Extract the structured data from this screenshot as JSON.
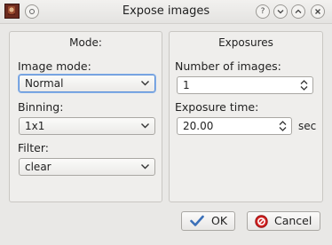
{
  "window": {
    "title": "Expose images"
  },
  "mode_panel": {
    "title": "Mode:",
    "image_mode_label": "Image mode:",
    "image_mode_value": "Normal",
    "binning_label": "Binning:",
    "binning_value": "1x1",
    "filter_label": "Filter:",
    "filter_value": "clear"
  },
  "exposures_panel": {
    "title": "Exposures",
    "num_images_label": "Number of images:",
    "num_images_value": "1",
    "exposure_time_label": "Exposure time:",
    "exposure_time_value": "20.00",
    "exposure_time_unit": "sec"
  },
  "buttons": {
    "ok_label": "OK",
    "cancel_label": "Cancel"
  },
  "titlebar_buttons": {
    "help": "?"
  },
  "icons": {
    "app": "app-photo-icon",
    "ok": "checkmark-icon",
    "cancel": "cancel-circle-icon"
  },
  "colors": {
    "focus": "#5b8fd8",
    "ok_check": "#3a6fb8",
    "cancel_red": "#d02020"
  }
}
